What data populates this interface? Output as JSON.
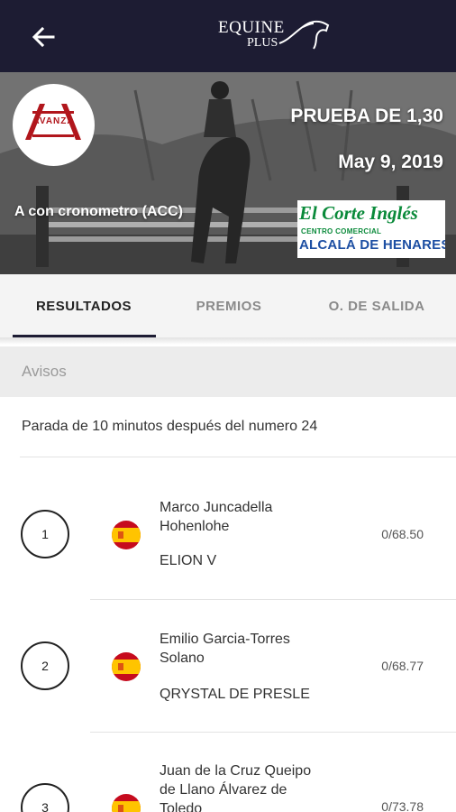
{
  "app": {
    "logo_line1": "EQUINE",
    "logo_line2": "PLUS",
    "back_icon": "back-arrow-icon"
  },
  "event": {
    "title": "PRUEBA DE 1,30",
    "date": "May 9, 2019",
    "mode": "A con cronometro (ACC)",
    "club_logo_text": "AVANZA",
    "sponsor_name": "El Corte Inglés",
    "sponsor_sub": "CENTRO COMERCIAL",
    "sponsor_city": "ALCALÁ DE HENARES"
  },
  "tabs": [
    {
      "label": "RESULTADOS",
      "active": true
    },
    {
      "label": "PREMIOS",
      "active": false
    },
    {
      "label": "O. DE SALIDA",
      "active": false
    }
  ],
  "notices": {
    "header": "Avisos",
    "text": "Parada de 10 minutos después del numero 24"
  },
  "results": [
    {
      "position": "1",
      "country_flag": "spain-flag-icon",
      "rider": "Marco Juncadella Hohenlohe",
      "horse": "ELION V",
      "score": "0/68.50"
    },
    {
      "position": "2",
      "country_flag": "spain-flag-icon",
      "rider": "Emilio Garcia-Torres Solano",
      "horse": "QRYSTAL DE PRESLE",
      "score": "0/68.77"
    },
    {
      "position": "3",
      "country_flag": "spain-flag-icon",
      "rider": "Juan de la Cruz Queipo de Llano Álvarez de Toledo",
      "horse": "",
      "score": "0/73.78"
    }
  ],
  "colors": {
    "topbar": "#1d1c33",
    "tab_indicator": "#1d1c33",
    "sponsor_green": "#0a8a3a",
    "sponsor_blue": "#1d4fa3",
    "club_red": "#b1161c"
  }
}
